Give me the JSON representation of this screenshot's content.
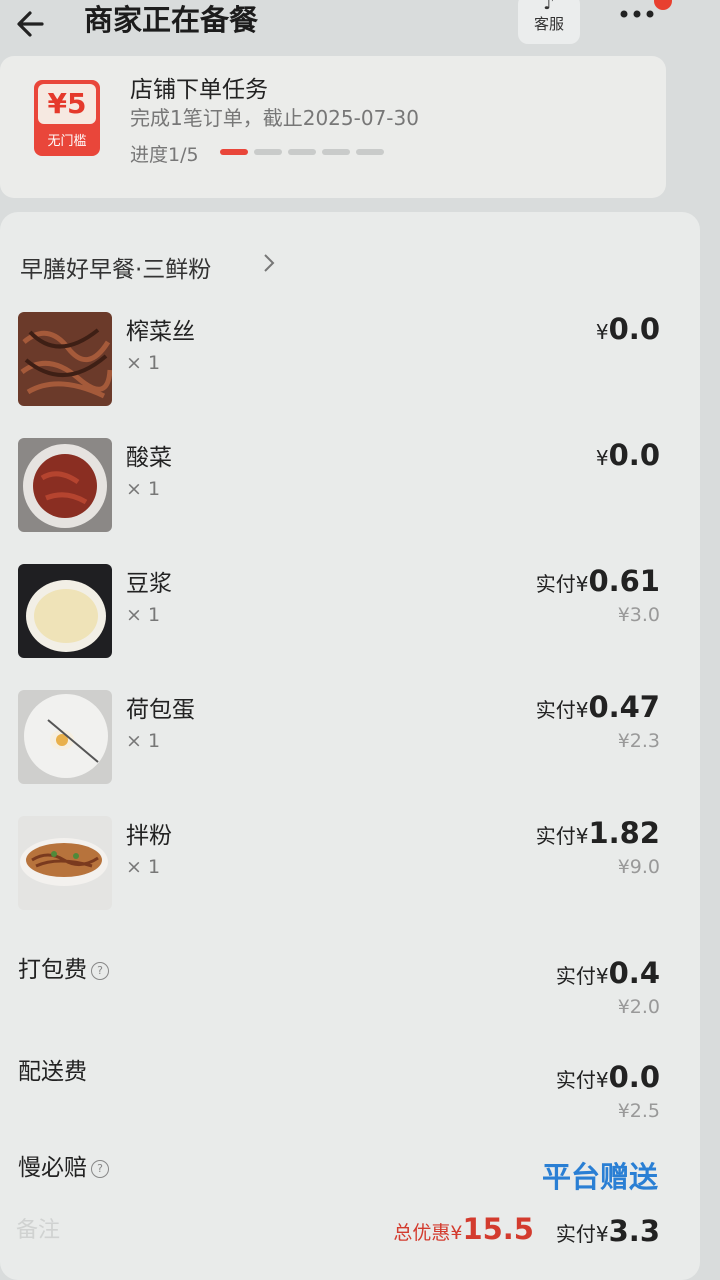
{
  "header": {
    "title": "商家正在备餐",
    "service_label": "客服"
  },
  "task": {
    "coupon_value": "¥5",
    "coupon_tag": "无门槛",
    "title": "店铺下单任务",
    "desc": "完成1笔订单，截止2025-07-30",
    "progress_text": "进度1/5",
    "progress_done": 1,
    "progress_total": 5
  },
  "shop": {
    "name": "早膳好早餐·三鲜粉"
  },
  "items": [
    {
      "name": "榨菜丝",
      "qty": "× 1",
      "price_prefix": "¥",
      "price": "0.0",
      "original": ""
    },
    {
      "name": "酸菜",
      "qty": "× 1",
      "price_prefix": "¥",
      "price": "0.0",
      "original": ""
    },
    {
      "name": "豆浆",
      "qty": "× 1",
      "price_prefix": "实付¥",
      "price": "0.61",
      "original": "¥3.0"
    },
    {
      "name": "荷包蛋",
      "qty": "× 1",
      "price_prefix": "实付¥",
      "price": "0.47",
      "original": "¥2.3"
    },
    {
      "name": "拌粉",
      "qty": "× 1",
      "price_prefix": "实付¥",
      "price": "1.82",
      "original": "¥9.0"
    }
  ],
  "fees": {
    "packing": {
      "label": "打包费",
      "price_prefix": "实付¥",
      "price": "0.4",
      "original": "¥2.0"
    },
    "delivery": {
      "label": "配送费",
      "price_prefix": "实付¥",
      "price": "0.0",
      "original": "¥2.5"
    },
    "late": {
      "label": "慢必赔",
      "value": "平台赠送"
    }
  },
  "footer": {
    "ghost_text": "备注",
    "total_discount_label": "总优惠¥",
    "total_discount": "15.5",
    "total_pay_label": "实付¥",
    "total_pay": "3.3"
  },
  "colors": {
    "accent_red": "#e9463a",
    "link_blue": "#2a7fd4"
  }
}
